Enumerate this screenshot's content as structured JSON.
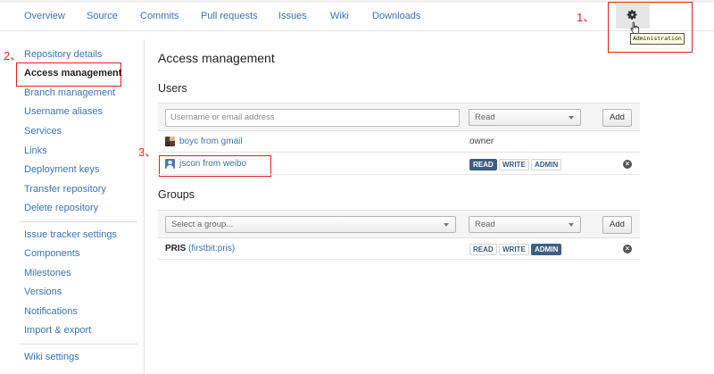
{
  "nav": {
    "tabs": [
      "Overview",
      "Source",
      "Commits",
      "Pull requests",
      "Issues",
      "Wiki",
      "Downloads"
    ],
    "admin_tooltip": "Administration"
  },
  "annotations": [
    "1、",
    "2、",
    "3、"
  ],
  "sidebar": {
    "group1": [
      "Repository details",
      "Access management",
      "Branch management",
      "Username aliases",
      "Services",
      "Links",
      "Deployment keys",
      "Transfer repository",
      "Delete repository"
    ],
    "group2": [
      "Issue tracker settings",
      "Components",
      "Milestones",
      "Versions",
      "Notifications",
      "Import & export"
    ],
    "group3": [
      "Wiki settings"
    ]
  },
  "main": {
    "title": "Access management",
    "users": {
      "heading": "Users",
      "input_placeholder": "Username or email address",
      "select_value": "Read",
      "add_label": "Add",
      "rows": [
        {
          "name": "boyc from gmail",
          "role": "owner"
        },
        {
          "name": "jscon from weibo",
          "perms": [
            "READ",
            "WRITE",
            "ADMIN"
          ],
          "active": "READ"
        }
      ]
    },
    "groups": {
      "heading": "Groups",
      "group_select": "Select a group...",
      "select_value": "Read",
      "add_label": "Add",
      "rows": [
        {
          "name": "PRIS",
          "slug": "(firstbit:pris)",
          "perms": [
            "READ",
            "WRITE",
            "ADMIN"
          ],
          "active": "ADMIN"
        }
      ]
    }
  },
  "colors": {
    "link": "#3b73af",
    "annotation": "#e0201e",
    "badge_active": "#3e5e82"
  }
}
